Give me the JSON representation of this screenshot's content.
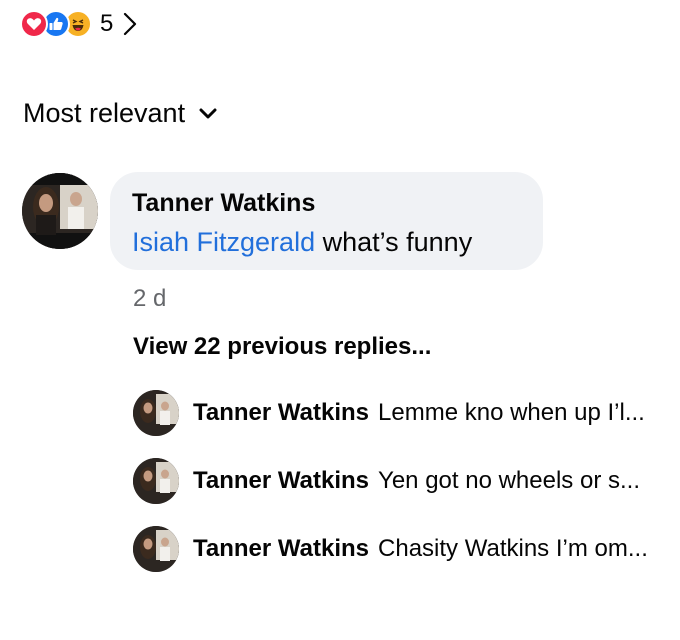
{
  "reactions": {
    "icons": [
      "love-icon",
      "like-icon",
      "haha-icon"
    ],
    "count": "5",
    "colors": {
      "love": "#f0284a",
      "like": "#1877f2",
      "haha": "#f7b125"
    }
  },
  "sort": {
    "label": "Most relevant"
  },
  "comment": {
    "author": "Tanner Watkins",
    "mention": "Isiah Fitzgerald",
    "text": " what’s funny",
    "timestamp": "2 d"
  },
  "view_replies": {
    "label": "View 22 previous replies..."
  },
  "replies": [
    {
      "author": "Tanner Watkins",
      "text": "Lemme kno when up I’l..."
    },
    {
      "author": "Tanner Watkins",
      "text": "Yen got no wheels or s..."
    },
    {
      "author": "Tanner Watkins",
      "text": "Chasity Watkins I’m om..."
    }
  ],
  "colors": {
    "bubble_bg": "#f0f2f5",
    "mention": "#216fdb",
    "secondary_text": "#65676b"
  }
}
